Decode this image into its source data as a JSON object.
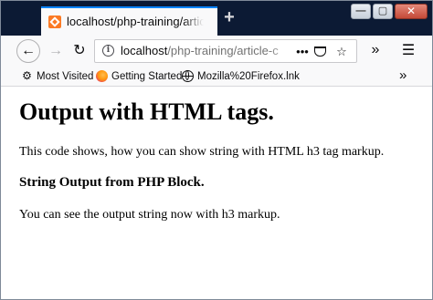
{
  "browser": {
    "tab": {
      "title": "localhost/php-training/article-c"
    },
    "window_controls": {
      "minimize": "—",
      "maximize": "▢",
      "close": "✕"
    },
    "new_tab_label": "+",
    "nav": {
      "back": "←",
      "forward": "→",
      "reload": "↻"
    },
    "url": {
      "host": "localhost",
      "path": "/php-training/article-c"
    },
    "url_actions": {
      "more": "•••",
      "bookmark": "☆"
    },
    "overflow": "»",
    "menu": "☰",
    "bookmarks": {
      "items": [
        {
          "label": "Most Visited",
          "icon": "gear-icon"
        },
        {
          "label": "Getting Started",
          "icon": "firefox-icon"
        },
        {
          "label": "Mozilla%20Firefox.lnk",
          "icon": "globe-icon"
        }
      ],
      "overflow": "»"
    },
    "colors": {
      "tab_bar": "#0c1a34",
      "accent": "#0a84ff",
      "toolbar": "#f9f9fa"
    }
  },
  "page": {
    "heading": "Output with HTML tags.",
    "paragraph1": "This code shows, how you can show string with HTML h3 tag markup.",
    "subheading": "String Output from PHP Block.",
    "paragraph2": "You can see the output string now with h3 markup."
  }
}
